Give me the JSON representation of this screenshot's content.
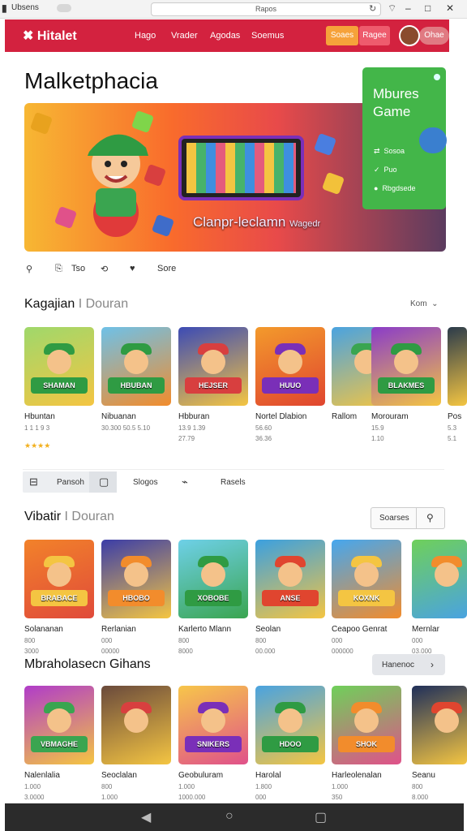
{
  "browser": {
    "app_label": "Ubsens",
    "url": "Rapos"
  },
  "nav": {
    "logo": "Hitalet",
    "links": [
      "Hago",
      "Vrader",
      "Agodas",
      "Soemus"
    ],
    "btn_orange": "Soaes",
    "btn_pink": "Ragee",
    "btn_avatar": "Ohae"
  },
  "page_title": "Malketphacia",
  "hero": {
    "caption": "Clanpr-leclamn",
    "caption_small": "Wagedr"
  },
  "side_panel": {
    "title_line1": "Mbures",
    "title_line2": "Game",
    "rows": [
      "Sosoa",
      "Puo",
      "Rbgdsede"
    ]
  },
  "actions": {
    "item2": "Tso",
    "item4": "Sore"
  },
  "section1": {
    "title": "Kagajian",
    "title_muted": "I Douran",
    "more": "Kom",
    "games": [
      {
        "name": "Hbuntan",
        "meta1": "1 1 1 9 3",
        "meta2": "",
        "rating": "★★★★"
      },
      {
        "name": "Nibuanan",
        "meta1": "30.300 50.5 5.10",
        "meta2": ""
      },
      {
        "name": "Hbburan",
        "meta1": "13.9 1.39",
        "meta2": "27.79"
      },
      {
        "name": "Nortel Dlabion",
        "meta1": "56.60",
        "meta2": "36.36"
      },
      {
        "name": "Rallom",
        "meta1": "",
        "meta2": ""
      },
      {
        "name": "Morouram",
        "meta1": "15.9",
        "meta2": "1.10"
      },
      {
        "name": "Pos",
        "meta1": "5.3",
        "meta2": "5.1"
      }
    ]
  },
  "filter_tabs": [
    "Pansoh",
    "Slogos",
    "Rasels"
  ],
  "section2": {
    "title": "Vibatir",
    "title_muted": "I Douran",
    "btn_left": "Soarses",
    "games": [
      {
        "name": "Solananan",
        "meta1": "800",
        "meta2": "3000"
      },
      {
        "name": "Rerlanian",
        "meta1": "000",
        "meta2": "00000"
      },
      {
        "name": "Karlerto Mlann",
        "meta1": "800",
        "meta2": "8000"
      },
      {
        "name": "Seolan",
        "meta1": "800",
        "meta2": "00.000"
      },
      {
        "name": "Ceapoo Genrat",
        "meta1": "000",
        "meta2": "000000"
      },
      {
        "name": "Mernlar",
        "meta1": "000",
        "meta2": "03.000"
      }
    ]
  },
  "section3": {
    "title": "Mbraholasecn Gihans",
    "btn_label": "Hanenoc",
    "games": [
      {
        "name": "Nalenlalia",
        "meta1": "1.000",
        "meta2": "3.0000"
      },
      {
        "name": "Seoclalan",
        "meta1": "800",
        "meta2": "1.000"
      },
      {
        "name": "Geobuluram",
        "meta1": "1.000",
        "meta2": "1000.000"
      },
      {
        "name": "Harolal",
        "meta1": "1.800",
        "meta2": "000"
      },
      {
        "name": "Harleolenalan",
        "meta1": "1.000",
        "meta2": "350"
      },
      {
        "name": "Seanu",
        "meta1": "800",
        "meta2": "8.000"
      }
    ]
  },
  "tile_labels": [
    "SHAMAN",
    "HBUBAN",
    "HEJSER",
    "HUUO",
    "",
    "BLAKMES",
    "",
    "BRABACE",
    "HBOBO",
    "XOBOBE",
    "ANSE",
    "KOXNK",
    "",
    "VBMAGHE",
    "",
    "SNIKERS",
    "HDOO",
    "SHOK",
    ""
  ]
}
